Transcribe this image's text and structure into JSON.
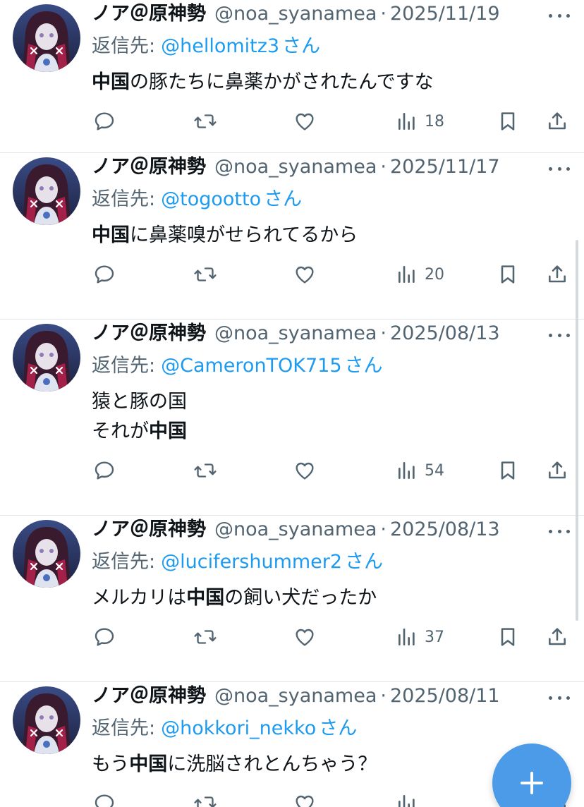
{
  "colors": {
    "text": "#0f1419",
    "muted": "#536471",
    "link": "#1d9bf0",
    "divider": "#e3e6e8",
    "fab": "#4c9be8"
  },
  "tweets": [
    {
      "author": {
        "name": "ノア＠原神勢",
        "handle": "@noa_syanamea"
      },
      "separator": "·",
      "date": "2025/11/19",
      "reply_to": {
        "prefix": "返信先:",
        "handle": "@hellomitz3",
        "suffix": "さん"
      },
      "lines": [
        [
          {
            "text": "中国",
            "bold": true
          },
          {
            "text": "の豚たちに鼻薬かがされたんですな",
            "bold": false
          }
        ]
      ],
      "views": "18"
    },
    {
      "author": {
        "name": "ノア＠原神勢",
        "handle": "@noa_syanamea"
      },
      "separator": "·",
      "date": "2025/11/17",
      "reply_to": {
        "prefix": "返信先:",
        "handle": "@togootto",
        "suffix": "さん"
      },
      "lines": [
        [
          {
            "text": "中国",
            "bold": true
          },
          {
            "text": "に鼻薬嗅がせられてるから",
            "bold": false
          }
        ]
      ],
      "views": "20"
    },
    {
      "author": {
        "name": "ノア＠原神勢",
        "handle": "@noa_syanamea"
      },
      "separator": "·",
      "date": "2025/08/13",
      "reply_to": {
        "prefix": "返信先:",
        "handle": "@CameronTOK715",
        "suffix": "さん"
      },
      "lines": [
        [
          {
            "text": "猿と豚の国",
            "bold": false
          }
        ],
        [
          {
            "text": "それが",
            "bold": false
          },
          {
            "text": "中国",
            "bold": true
          }
        ]
      ],
      "views": "54"
    },
    {
      "author": {
        "name": "ノア＠原神勢",
        "handle": "@noa_syanamea"
      },
      "separator": "·",
      "date": "2025/08/13",
      "reply_to": {
        "prefix": "返信先:",
        "handle": "@lucifershummer2",
        "suffix": "さん"
      },
      "lines": [
        [
          {
            "text": "メルカリは",
            "bold": false
          },
          {
            "text": "中国",
            "bold": true
          },
          {
            "text": "の飼い犬だったか",
            "bold": false
          }
        ]
      ],
      "views": "37"
    },
    {
      "author": {
        "name": "ノア＠原神勢",
        "handle": "@noa_syanamea"
      },
      "separator": "·",
      "date": "2025/08/11",
      "reply_to": {
        "prefix": "返信先:",
        "handle": "@hokkori_nekko",
        "suffix": "さん"
      },
      "lines": [
        [
          {
            "text": "もう",
            "bold": false
          },
          {
            "text": "中国",
            "bold": true
          },
          {
            "text": "に洗脳されとんちゃう？",
            "bold": false
          }
        ]
      ],
      "views": ""
    }
  ],
  "icons": {
    "reply": "speech-bubble-icon",
    "retweet": "retweet-icon",
    "like": "heart-icon",
    "views": "bar-chart-icon",
    "bookmark": "bookmark-icon",
    "share": "share-icon",
    "more": "more-dots-icon",
    "compose": "plus-icon"
  }
}
